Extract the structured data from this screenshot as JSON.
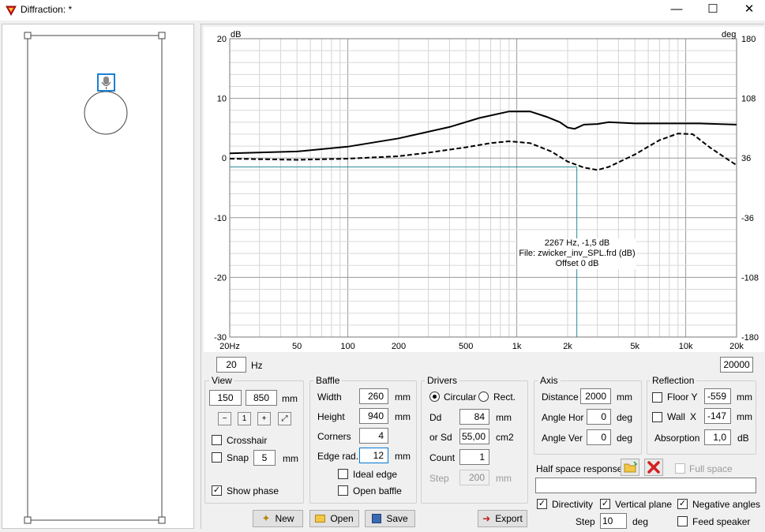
{
  "window": {
    "title": "Diffraction: *",
    "min": "—",
    "max": "☐",
    "close": "✕"
  },
  "plot": {
    "left_unit": "dB",
    "right_unit": "deg",
    "y_left_ticks": [
      "20",
      "10",
      "0",
      "-10",
      "-20",
      "-30"
    ],
    "y_right_ticks": [
      "180",
      "108",
      "36",
      "-36",
      "-108",
      "-180"
    ],
    "x_ticks": [
      "20Hz",
      "50",
      "100",
      "200",
      "500",
      "1k",
      "2k",
      "5k",
      "10k",
      "20k"
    ],
    "cursor": {
      "freq_hz": 2267,
      "db": -1.5
    },
    "tooltip": {
      "line1": "2267 Hz, -1,5 dB",
      "line2": "File: zwicker_inv_SPL.frd (dB)",
      "line3": "Offset 0 dB"
    }
  },
  "range": {
    "min": "20",
    "unit": "Hz",
    "max": "20000"
  },
  "view": {
    "legend": "View",
    "v1": "150",
    "v2": "850",
    "unit": "mm",
    "crosshair": "Crosshair",
    "snap": "Snap",
    "snap_value": "5",
    "snap_unit": "mm",
    "show_phase": "Show phase",
    "zoom_icons": [
      "zoom-out-icon",
      "zoom-reset-icon",
      "zoom-in-icon",
      "zoom-fit-icon"
    ]
  },
  "baffle": {
    "legend": "Baffle",
    "width_label": "Width",
    "width": "260",
    "width_unit": "mm",
    "height_label": "Height",
    "height": "940",
    "height_unit": "mm",
    "corners_label": "Corners",
    "corners": "4",
    "edge_label": "Edge rad.",
    "edge": "12",
    "edge_unit": "mm",
    "ideal_edge": "Ideal edge",
    "open_baffle": "Open baffle"
  },
  "drivers": {
    "legend": "Drivers",
    "circular": "Circular",
    "rect": "Rect.",
    "dd_label": "Dd",
    "dd": "84",
    "dd_unit": "mm",
    "sd_label": "or Sd",
    "sd": "55,00",
    "sd_unit": "cm2",
    "count_label": "Count",
    "count": "1",
    "step_label": "Step",
    "step": "200",
    "step_unit": "mm"
  },
  "axis": {
    "legend": "Axis",
    "distance_label": "Distance",
    "distance": "2000",
    "distance_unit": "mm",
    "hor_label": "Angle Hor",
    "hor": "0",
    "hor_unit": "deg",
    "ver_label": "Angle Ver",
    "ver": "0",
    "ver_unit": "deg"
  },
  "reflection": {
    "legend": "Reflection",
    "floor_label": "Floor Y",
    "floor": "-559",
    "floor_unit": "mm",
    "wall_label": "Wall",
    "wall_axis": "X",
    "wall": "-147",
    "wall_unit": "mm",
    "absorption_label": "Absorption",
    "absorption": "1,0",
    "absorption_unit": "dB"
  },
  "half_space": {
    "label": "Half space response",
    "full_space": "Full space",
    "value": ""
  },
  "options": {
    "directivity": "Directivity",
    "vertical_plane": "Vertical plane",
    "negative_angles": "Negative angles",
    "step_label": "Step",
    "step": "10",
    "step_unit": "deg",
    "feed_speaker": "Feed speaker"
  },
  "buttons": {
    "new": "New",
    "open": "Open",
    "save": "Save",
    "export": "Export"
  },
  "colors": {
    "accent": "#0078d7",
    "cursor": "#2a8a9a",
    "grid": "#c8c8c8"
  }
}
